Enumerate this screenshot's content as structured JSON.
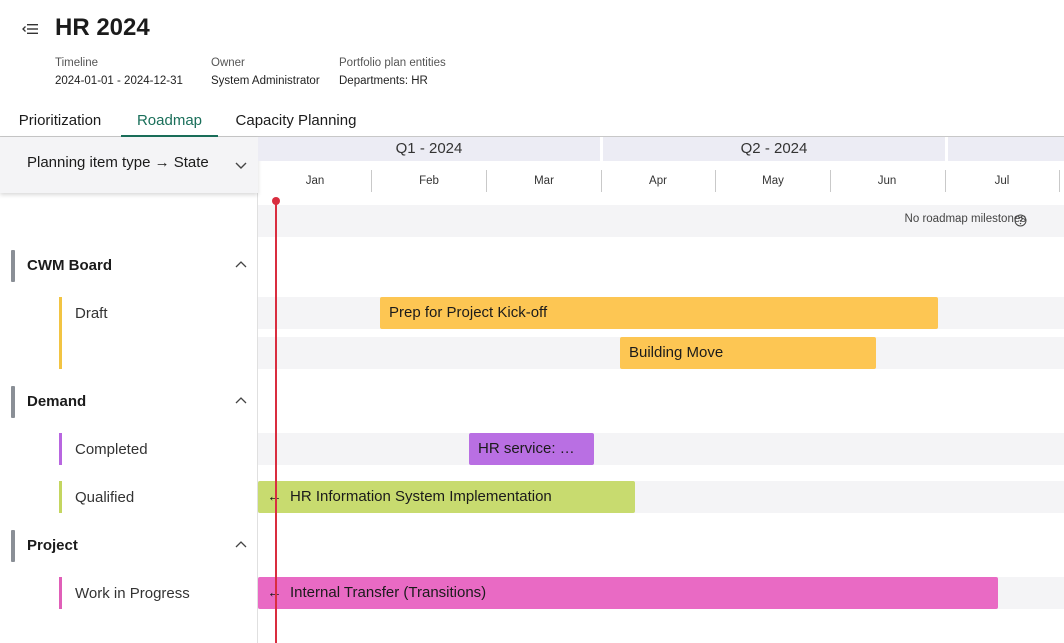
{
  "plan": {
    "title": "HR 2024",
    "timeline_label": "Timeline",
    "timeline_value": "2024-01-01 - 2024-12-31",
    "owner_label": "Owner",
    "owner_value": "System Administrator",
    "entities_label": "Portfolio plan entities",
    "entities_value": "Departments: HR"
  },
  "tabs": [
    "Prioritization",
    "Roadmap",
    "Capacity Planning"
  ],
  "active_tab": "Roadmap",
  "grouping": {
    "label": "Planning item type → State"
  },
  "timeline": {
    "quarters": [
      "Q1 - 2024",
      "Q2 - 2024"
    ],
    "months": [
      "Jan",
      "Feb",
      "Mar",
      "Apr",
      "May",
      "Jun",
      "Jul"
    ],
    "milestone_note": "No roadmap milestones"
  },
  "groups": [
    {
      "title": "CWM Board",
      "states": [
        {
          "label": "Draft",
          "color": "#f2c443"
        }
      ]
    },
    {
      "title": "Demand",
      "states": [
        {
          "label": "Completed",
          "color": "#b866e0"
        },
        {
          "label": "Qualified",
          "color": "#c4d660"
        }
      ]
    },
    {
      "title": "Project",
      "states": [
        {
          "label": "Work in Progress",
          "color": "#e05fb8"
        }
      ]
    }
  ],
  "items": [
    {
      "label": "Prep for Project Kick-off",
      "color": "#fdc653",
      "continues_left": false
    },
    {
      "label": "Building Move",
      "color": "#fdc653",
      "continues_left": false
    },
    {
      "label": "HR service: …",
      "color": "#b96fe3",
      "continues_left": false
    },
    {
      "label": "HR Information System Implementation",
      "color": "#c8db6f",
      "continues_left": true
    },
    {
      "label": "Internal Transfer (Transitions)",
      "color": "#e96ac4",
      "continues_left": true
    }
  ],
  "colors": {
    "accent": "#1a6f5a",
    "today_line": "#d92d3f",
    "group_bar": "#8a8f96"
  },
  "icons": [
    "collapse-menu-icon",
    "chevron-down-icon",
    "chevron-up-icon",
    "help-circle-icon",
    "arrow-left-icon"
  ]
}
